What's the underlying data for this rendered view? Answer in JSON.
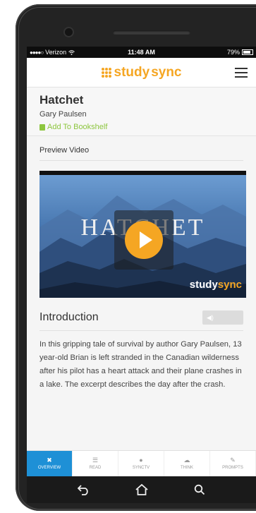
{
  "status": {
    "signal_dots": "●●●●○",
    "carrier": "Verizon",
    "time": "11:48 AM",
    "battery": "79%"
  },
  "app": {
    "logo_study": "study",
    "logo_sync": "sync",
    "brand_color": "#f5a623"
  },
  "book": {
    "title": "Hatchet",
    "author": "Gary Paulsen",
    "bookshelf_label": "Add To Bookshelf"
  },
  "preview": {
    "label": "Preview Video",
    "video_title": "HATCHET",
    "watermark_study": "study",
    "watermark_sync": "sync"
  },
  "introduction": {
    "label": "Introduction",
    "text": "In this gripping tale of survival by author Gary Paulsen, 13 year-old Brian is left stranded in the Canadian wilderness after his pilot has a heart attack and their plane crashes in a lake. The excerpt describes the day after the crash."
  },
  "tabs": [
    {
      "label": "OVERVIEW",
      "icon": "overview-icon"
    },
    {
      "label": "READ",
      "icon": "read-icon"
    },
    {
      "label": "SYNCTV",
      "icon": "synctv-icon"
    },
    {
      "label": "THINK",
      "icon": "think-icon"
    },
    {
      "label": "PROMPTS",
      "icon": "prompts-icon"
    }
  ],
  "colors": {
    "accent_green": "#8dc63f",
    "tab_active": "#1e90d6"
  }
}
